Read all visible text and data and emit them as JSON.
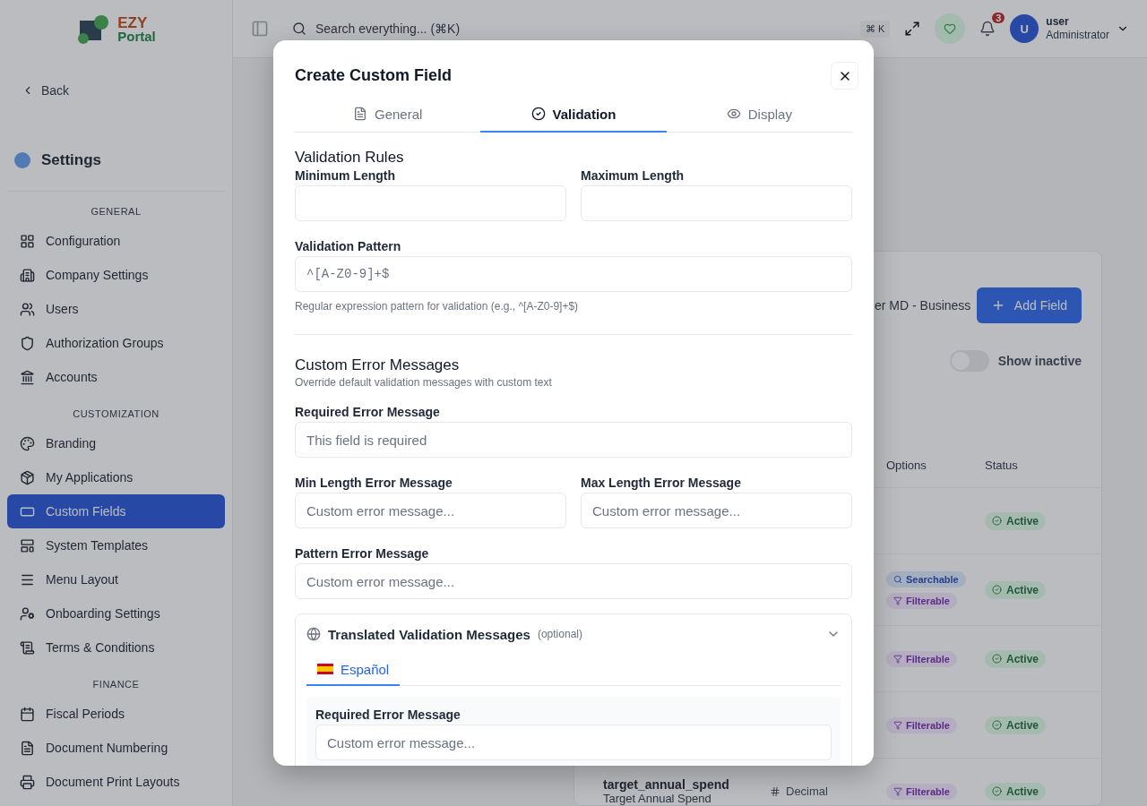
{
  "app": {
    "logo": {
      "line1": "EZY",
      "line2": "Portal"
    },
    "search_placeholder": "Search everything... (⌘K)",
    "shortcut": "⌘ K",
    "notification_count": "3",
    "user": {
      "avatar": "U",
      "name": "user",
      "role": "Administrator"
    }
  },
  "sidebar": {
    "back": "Back",
    "title": "Settings",
    "sections": [
      {
        "heading": "GENERAL",
        "items": [
          {
            "label": "Configuration",
            "selected": false
          },
          {
            "label": "Company Settings",
            "selected": false
          },
          {
            "label": "Users",
            "selected": false
          },
          {
            "label": "Authorization Groups",
            "selected": false
          },
          {
            "label": "Accounts",
            "selected": false
          }
        ]
      },
      {
        "heading": "CUSTOMIZATION",
        "items": [
          {
            "label": "Branding",
            "selected": false
          },
          {
            "label": "My Applications",
            "selected": false
          },
          {
            "label": "Custom Fields",
            "selected": true
          },
          {
            "label": "System Templates",
            "selected": false
          },
          {
            "label": "Menu Layout",
            "selected": false
          },
          {
            "label": "Onboarding Settings",
            "selected": false
          },
          {
            "label": "Terms & Conditions",
            "selected": false
          }
        ]
      },
      {
        "heading": "FINANCE",
        "items": [
          {
            "label": "Fiscal Periods",
            "selected": false
          },
          {
            "label": "Document Numbering",
            "selected": false
          },
          {
            "label": "Document Print Layouts",
            "selected": false
          }
        ]
      }
    ]
  },
  "page": {
    "description_tail": "er MD - Business",
    "add_button": "Add Field",
    "show_inactive": {
      "label": "Show inactive",
      "on": false
    },
    "table": {
      "columns": [
        "Options",
        "Status"
      ],
      "rows": [
        {
          "options": [],
          "status": "Active"
        },
        {
          "options": [
            {
              "label": "Searchable",
              "kind": "searchable"
            },
            {
              "label": "Filterable",
              "kind": "filterable"
            }
          ],
          "status": "Active"
        },
        {
          "options": [
            {
              "label": "Filterable",
              "kind": "filterable"
            }
          ],
          "status": "Active"
        },
        {
          "options": [
            {
              "label": "Filterable",
              "kind": "filterable"
            }
          ],
          "status": "Active"
        },
        {
          "name": "target_annual_spend",
          "label": "Target Annual Spend",
          "type": "Decimal",
          "options": [
            {
              "label": "Filterable",
              "kind": "filterable"
            }
          ],
          "status": "Active"
        }
      ]
    }
  },
  "modal": {
    "title": "Create Custom Field",
    "tabs": [
      {
        "label": "General",
        "selected": false
      },
      {
        "label": "Validation",
        "selected": true
      },
      {
        "label": "Display",
        "selected": false
      }
    ],
    "rules": {
      "heading": "Validation Rules",
      "min_label": "Minimum Length",
      "max_label": "Maximum Length",
      "pattern_label": "Validation Pattern",
      "pattern_placeholder": "^[A-Z0-9]+$",
      "pattern_help": "Regular expression pattern for validation (e.g., ^[A-Z0-9]+$)"
    },
    "errors": {
      "heading": "Custom Error Messages",
      "subtitle": "Override default validation messages with custom text",
      "required_label": "Required Error Message",
      "required_placeholder": "This field is required",
      "min_label": "Min Length Error Message",
      "min_placeholder": "Custom error message...",
      "max_label": "Max Length Error Message",
      "max_placeholder": "Custom error message...",
      "pattern_label": "Pattern Error Message",
      "pattern_placeholder": "Custom error message..."
    },
    "translations": {
      "title": "Translated Validation Messages",
      "optional": "(optional)",
      "expanded": true,
      "languages": [
        {
          "label": "Español",
          "selected": true
        }
      ],
      "required_label": "Required Error Message",
      "required_placeholder": "Custom error message..."
    }
  }
}
